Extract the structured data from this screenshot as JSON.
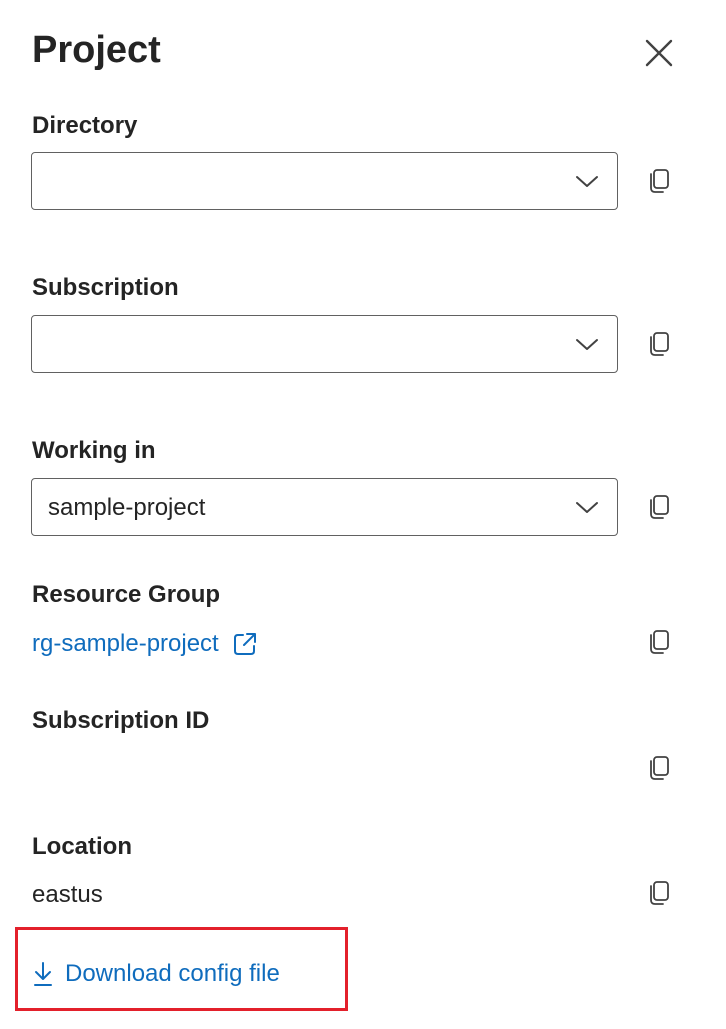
{
  "panel": {
    "title": "Project"
  },
  "fields": {
    "directory": {
      "label": "Directory",
      "value": ""
    },
    "subscription": {
      "label": "Subscription",
      "value": ""
    },
    "working_in": {
      "label": "Working in",
      "value": "sample-project"
    },
    "resource_group": {
      "label": "Resource Group",
      "value": "rg-sample-project"
    },
    "subscription_id": {
      "label": "Subscription ID",
      "value": ""
    },
    "location": {
      "label": "Location",
      "value": "eastus"
    }
  },
  "actions": {
    "download_label": "Download config file"
  },
  "colors": {
    "link": "#0f6cbd",
    "highlight": "#e3202b",
    "text": "#242424"
  },
  "icons": [
    "close-icon",
    "chevron-down-icon",
    "copy-icon",
    "external-link-icon",
    "download-icon"
  ]
}
